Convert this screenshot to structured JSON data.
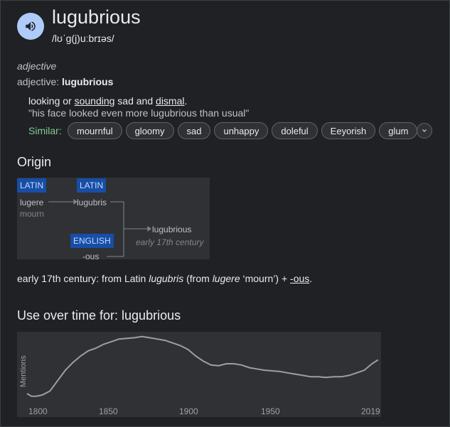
{
  "word": "lugubrious",
  "phonetic": "/lʊˈɡ(j)uːbrɪəs/",
  "pos_italic": "adjective",
  "pos_label": "adjective: ",
  "pos_word": "lugubrious",
  "definition": {
    "part1": "looking or ",
    "link1": "sounding",
    "part2": " sad and ",
    "link2": "dismal",
    "part3": "."
  },
  "example": "\"his face looked even more lugubrious than usual\"",
  "similar_label": "Similar:",
  "similar": [
    "mournful",
    "gloomy",
    "sad",
    "unhappy",
    "doleful",
    "Eeyorish",
    "glum"
  ],
  "origin": {
    "heading": "Origin",
    "tag_latin_1": "LATIN",
    "tag_latin_2": "LATIN",
    "tag_english": "ENGLISH",
    "lugere": "lugere",
    "mourn": "mourn",
    "lugubris": "lugubris",
    "lugubrious": "lugubrious",
    "century": "early 17th century",
    "ous": "-ous"
  },
  "etymology": {
    "p1": "early 17th century: from Latin ",
    "i1": "lugubris",
    "p2": " (from ",
    "i2": "lugere",
    "p3": " ‘mourn’) + ",
    "link": "-ous",
    "p4": "."
  },
  "usage": {
    "heading": "Use over time for: lugubrious",
    "ylabel": "Mentions"
  },
  "chart_data": {
    "type": "line",
    "title": "Use over time for: lugubrious",
    "xlabel": "",
    "ylabel": "Mentions",
    "xlim": [
      1790,
      2020
    ],
    "x_ticks": [
      "1800",
      "1850",
      "1900",
      "1950",
      "2019"
    ],
    "x": [
      1790,
      1793,
      1796,
      1800,
      1805,
      1810,
      1815,
      1820,
      1825,
      1830,
      1835,
      1840,
      1845,
      1850,
      1855,
      1860,
      1865,
      1870,
      1875,
      1880,
      1885,
      1890,
      1895,
      1900,
      1905,
      1910,
      1915,
      1920,
      1925,
      1930,
      1935,
      1940,
      1945,
      1950,
      1955,
      1960,
      1965,
      1970,
      1975,
      1980,
      1985,
      1990,
      1995,
      2000,
      2005,
      2010,
      2015,
      2019
    ],
    "values": [
      12,
      8,
      8,
      10,
      16,
      32,
      48,
      60,
      70,
      78,
      82,
      88,
      92,
      96,
      97,
      98,
      100,
      98,
      96,
      94,
      90,
      86,
      80,
      70,
      62,
      56,
      55,
      58,
      58,
      56,
      52,
      50,
      48,
      47,
      46,
      44,
      42,
      40,
      38,
      38,
      37,
      38,
      38,
      40,
      44,
      48,
      58,
      64
    ],
    "ylim": [
      0,
      105
    ],
    "grid": false,
    "line_color": "#9aa0a6"
  },
  "colors": {
    "accent_speaker": "#aecbfa",
    "similar_green": "#81c995",
    "tag_bg": "#174ea6"
  }
}
